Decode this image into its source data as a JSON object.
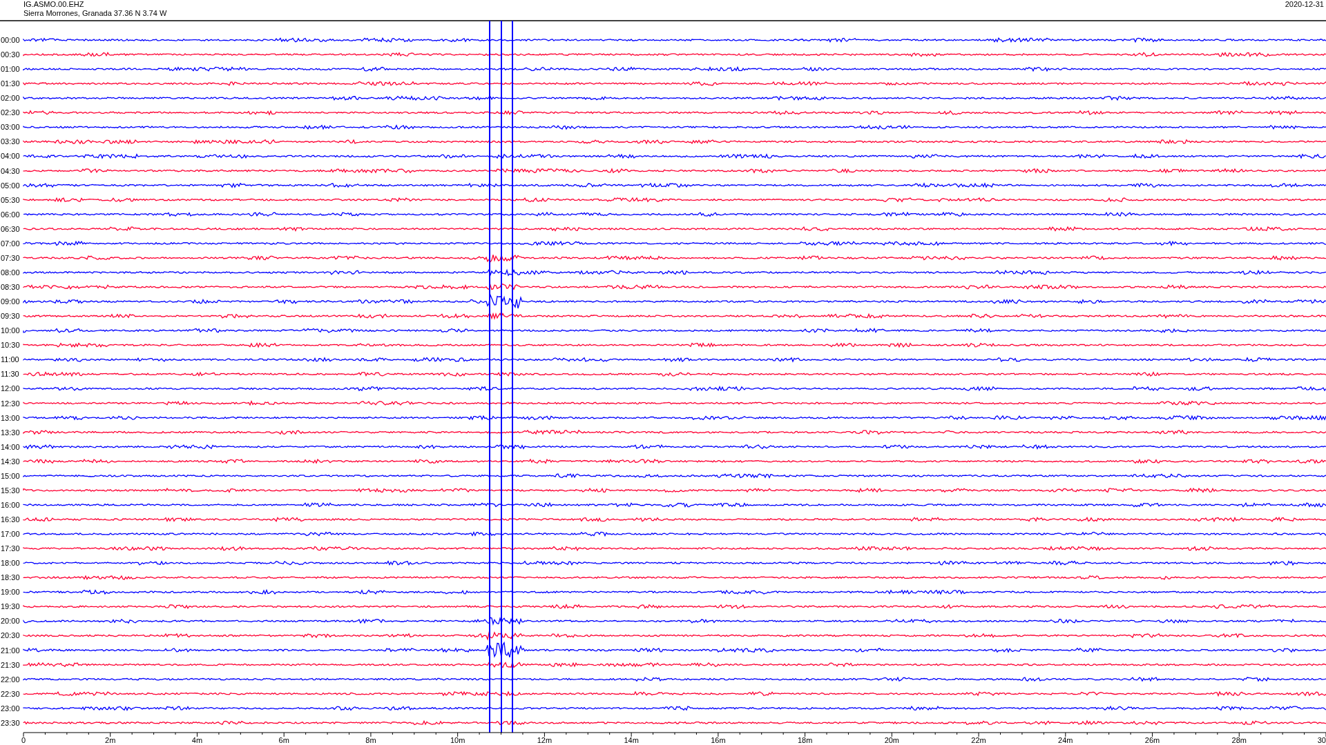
{
  "header": {
    "station": "IG.ASMO.00.EHZ",
    "location": "Sierra Morrones, Granada  37.36 N 3.74 W",
    "date": "2020-12-31"
  },
  "rows": [
    {
      "label": "00:00",
      "color": "#0000ff"
    },
    {
      "label": "00:30",
      "color": "#ff0033"
    },
    {
      "label": "01:00",
      "color": "#0000ff"
    },
    {
      "label": "01:30",
      "color": "#ff0033"
    },
    {
      "label": "02:00",
      "color": "#0000ff"
    },
    {
      "label": "02:30",
      "color": "#ff0033"
    },
    {
      "label": "03:00",
      "color": "#0000ff"
    },
    {
      "label": "03:30",
      "color": "#ff0033"
    },
    {
      "label": "04:00",
      "color": "#0000ff"
    },
    {
      "label": "04:30",
      "color": "#ff0033"
    },
    {
      "label": "05:00",
      "color": "#0000ff"
    },
    {
      "label": "05:30",
      "color": "#ff0033"
    },
    {
      "label": "06:00",
      "color": "#0000ff"
    },
    {
      "label": "06:30",
      "color": "#ff0033"
    },
    {
      "label": "07:00",
      "color": "#0000ff"
    },
    {
      "label": "07:30",
      "color": "#ff0033"
    },
    {
      "label": "08:00",
      "color": "#0000ff"
    },
    {
      "label": "08:30",
      "color": "#ff0033"
    },
    {
      "label": "09:00",
      "color": "#0000ff"
    },
    {
      "label": "09:30",
      "color": "#ff0033"
    },
    {
      "label": "10:00",
      "color": "#0000ff"
    },
    {
      "label": "10:30",
      "color": "#ff0033"
    },
    {
      "label": "11:00",
      "color": "#0000ff"
    },
    {
      "label": "11:30",
      "color": "#ff0033"
    },
    {
      "label": "12:00",
      "color": "#0000ff"
    },
    {
      "label": "12:30",
      "color": "#ff0033"
    },
    {
      "label": "13:00",
      "color": "#0000ff"
    },
    {
      "label": "13:30",
      "color": "#ff0033"
    },
    {
      "label": "14:00",
      "color": "#0000ff"
    },
    {
      "label": "14:30",
      "color": "#ff0033"
    },
    {
      "label": "15:00",
      "color": "#0000ff"
    },
    {
      "label": "15:30",
      "color": "#ff0033"
    },
    {
      "label": "16:00",
      "color": "#0000ff"
    },
    {
      "label": "16:30",
      "color": "#ff0033"
    },
    {
      "label": "17:00",
      "color": "#0000ff"
    },
    {
      "label": "17:30",
      "color": "#ff0033"
    },
    {
      "label": "18:00",
      "color": "#0000ff"
    },
    {
      "label": "18:30",
      "color": "#ff0033"
    },
    {
      "label": "19:00",
      "color": "#0000ff"
    },
    {
      "label": "19:30",
      "color": "#ff0033"
    },
    {
      "label": "20:00",
      "color": "#0000ff"
    },
    {
      "label": "20:30",
      "color": "#ff0033"
    },
    {
      "label": "21:00",
      "color": "#0000ff"
    },
    {
      "label": "21:30",
      "color": "#ff0033"
    },
    {
      "label": "22:00",
      "color": "#0000ff"
    },
    {
      "label": "22:30",
      "color": "#ff0033"
    },
    {
      "label": "23:00",
      "color": "#0000ff"
    },
    {
      "label": "23:30",
      "color": "#ff0033"
    }
  ],
  "x_axis": {
    "ticks": [
      "0",
      "2m",
      "4m",
      "6m",
      "8m",
      "10m",
      "12m",
      "14m",
      "16m",
      "18m",
      "20m",
      "22m",
      "24m",
      "26m",
      "28m",
      "30"
    ]
  }
}
